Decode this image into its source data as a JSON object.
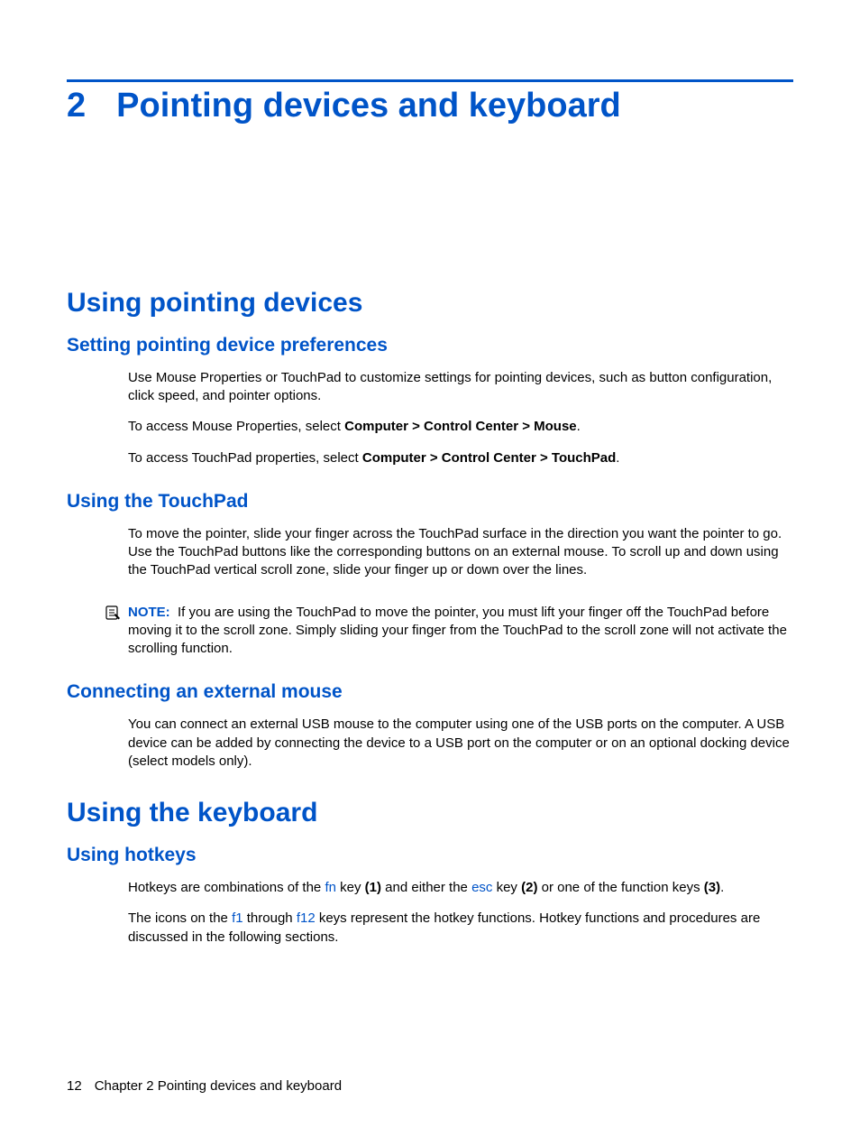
{
  "chapter": {
    "number": "2",
    "title": "Pointing devices and keyboard"
  },
  "section1": {
    "heading": "Using pointing devices",
    "sub1": {
      "heading": "Setting pointing device preferences",
      "p1": "Use Mouse Properties or TouchPad to customize settings for pointing devices, such as button configuration, click speed, and pointer options.",
      "p2a": "To access Mouse Properties, select ",
      "p2b": "Computer > Control Center > Mouse",
      "p2c": ".",
      "p3a": "To access TouchPad properties, select ",
      "p3b": "Computer > Control Center > TouchPad",
      "p3c": "."
    },
    "sub2": {
      "heading": "Using the TouchPad",
      "p1": "To move the pointer, slide your finger across the TouchPad surface in the direction you want the pointer to go. Use the TouchPad buttons like the corresponding buttons on an external mouse. To scroll up and down using the TouchPad vertical scroll zone, slide your finger up or down over the lines.",
      "note_label": "NOTE:",
      "note_text": "If you are using the TouchPad to move the pointer, you must lift your finger off the TouchPad before moving it to the scroll zone. Simply sliding your finger from the TouchPad to the scroll zone will not activate the scrolling function."
    },
    "sub3": {
      "heading": "Connecting an external mouse",
      "p1": "You can connect an external USB mouse to the computer using one of the USB ports on the computer. A USB device can be added by connecting the device to a USB port on the computer or on an optional docking device (select models only)."
    }
  },
  "section2": {
    "heading": "Using the keyboard",
    "sub1": {
      "heading": "Using hotkeys",
      "p1": {
        "t1": "Hotkeys are combinations of the ",
        "k1": "fn",
        "t2": " key ",
        "b1": "(1)",
        "t3": " and either the ",
        "k2": "esc",
        "t4": " key ",
        "b2": "(2)",
        "t5": " or one of the function keys ",
        "b3": "(3)",
        "t6": "."
      },
      "p2": {
        "t1": "The icons on the ",
        "k1": "f1",
        "t2": " through ",
        "k2": "f12",
        "t3": " keys represent the hotkey functions. Hotkey functions and procedures are discussed in the following sections."
      }
    }
  },
  "footer": {
    "page_number": "12",
    "chapter_ref": "Chapter 2   Pointing devices and keyboard"
  }
}
